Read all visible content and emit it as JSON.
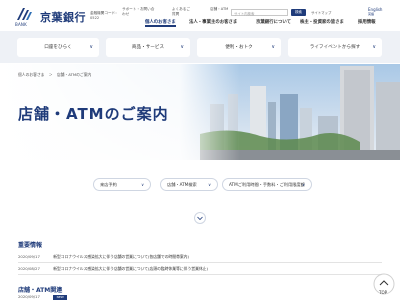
{
  "header": {
    "logo_sub": "BANK",
    "brand": "京葉銀行",
    "bank_code": "金融機関コード：0522",
    "links": {
      "support": "サポート・お問い合わせ",
      "faq": "よくあるご質問",
      "branch_atm": "店舗・ATM"
    },
    "search": {
      "placeholder": "サイト内検索",
      "button": "検索"
    },
    "sitemap": "サイトマップ",
    "english": "English",
    "english_sub": "英語"
  },
  "global_nav": {
    "items": [
      {
        "label": "個人のお客さま",
        "active": true
      },
      {
        "label": "法人・事業主のお客さま",
        "active": false
      },
      {
        "label": "京葉銀行について",
        "active": false
      },
      {
        "label": "株主・投資家の皆さま",
        "active": false
      },
      {
        "label": "採用情報",
        "active": false
      }
    ]
  },
  "sub_nav": {
    "items": [
      {
        "label": "口座をひらく"
      },
      {
        "label": "商品・サービス"
      },
      {
        "label": "便利・おトク"
      },
      {
        "label": "ライフイベントから探す"
      }
    ],
    "chevron": "∨"
  },
  "hero": {
    "breadcrumb": [
      "個人のお客さま",
      "店舗・ATMのご案内"
    ],
    "breadcrumb_sep": "＞",
    "title": "店舗・ATMのご案内"
  },
  "filters": {
    "items": [
      {
        "label": "来店予約"
      },
      {
        "label": "店舗・ATM検索"
      },
      {
        "label": "ATMご利用時間・手数料・ご利用限度額"
      }
    ],
    "chevron": "∨"
  },
  "notices": {
    "title": "重要情報",
    "items": [
      {
        "date": "2020/09/17",
        "text": "新型コロナウイルス感染拡大に伴う店舗の営業について(各店舗での時間帯案内)"
      },
      {
        "date": "2020/08/27",
        "text": "新型コロナウイルス感染拡大に伴う店舗の営業について(店頭の臨時休業等に伴う営業休止)"
      }
    ]
  },
  "branch_news": {
    "title": "店舗・ATM関連",
    "items": [
      {
        "date": "2020/09/17",
        "tag": "NEW",
        "text": ""
      }
    ]
  },
  "page_top": {
    "label": "TOP"
  },
  "colors": {
    "accent": "#1f3b7a",
    "subnav_bg": "#eef1f6",
    "tag": "#1f3b7a"
  }
}
